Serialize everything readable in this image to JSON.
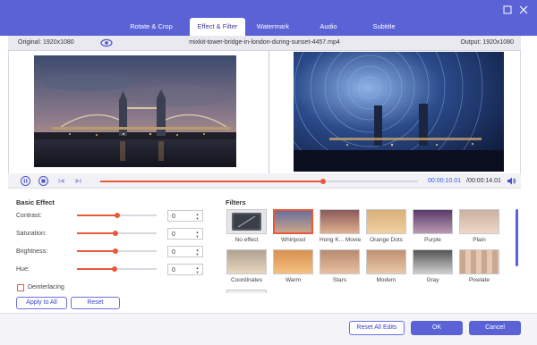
{
  "tabs": [
    "Rotate & Crop",
    "Effect & Filter",
    "Watermark",
    "Audio",
    "Subtitle"
  ],
  "active_tab": "Effect & Filter",
  "window": {
    "restore_icon": "restore-icon",
    "close_icon": "close-icon"
  },
  "infobar": {
    "original": "Original: 1920x1080",
    "filename": "mixkit-tower-bridge-in-london-during-sunset-4457.mp4",
    "output": "Output: 1920x1080"
  },
  "player": {
    "current_time": "00:00:10.01",
    "total_time": "/00:00:14.01",
    "progress": 0.7
  },
  "basic_effect": {
    "title": "Basic Effect",
    "rows": [
      {
        "label": "Contrast:",
        "value": "0",
        "level": 0.5
      },
      {
        "label": "Saturation:",
        "value": "0",
        "level": 0.48
      },
      {
        "label": "Brightness:",
        "value": "0",
        "level": 0.48
      },
      {
        "label": "Hue:",
        "value": "0",
        "level": 0.47
      }
    ],
    "deinterlacing": "Deinterlacing",
    "apply_all": "Apply to All",
    "reset": "Reset"
  },
  "filters": {
    "title": "Filters",
    "items": [
      "No effect",
      "Whirlpool",
      "Hong K... Movie",
      "Orange Dots",
      "Purple",
      "Plain",
      "Coordinates",
      "Warm",
      "Stars",
      "Modern",
      "Gray",
      "Pixelate"
    ],
    "selected": "Whirlpool"
  },
  "footer": {
    "reset_all": "Reset All Edits",
    "ok": "OK",
    "cancel": "Cancel"
  },
  "colors": {
    "accent": "#5a62d6",
    "highlight": "#e9583a",
    "time": "#2c5ee0"
  }
}
